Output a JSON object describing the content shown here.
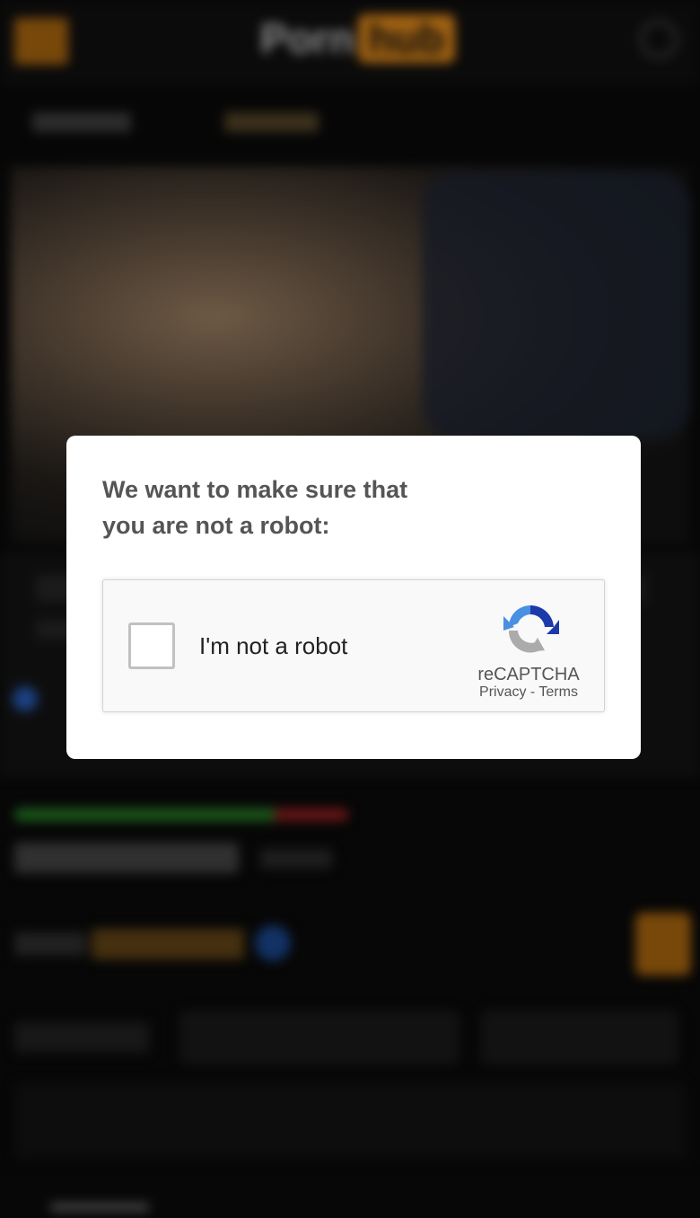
{
  "background": {
    "logo_text_left": "Porn",
    "logo_text_right": "hub"
  },
  "modal": {
    "title_line1": "We want to make sure that",
    "title_line2": "you are not a robot:"
  },
  "recaptcha": {
    "checkbox_label": "I'm not a robot",
    "brand": "reCAPTCHA",
    "privacy_link": "Privacy",
    "separator": " - ",
    "terms_link": "Terms",
    "checked": false
  }
}
